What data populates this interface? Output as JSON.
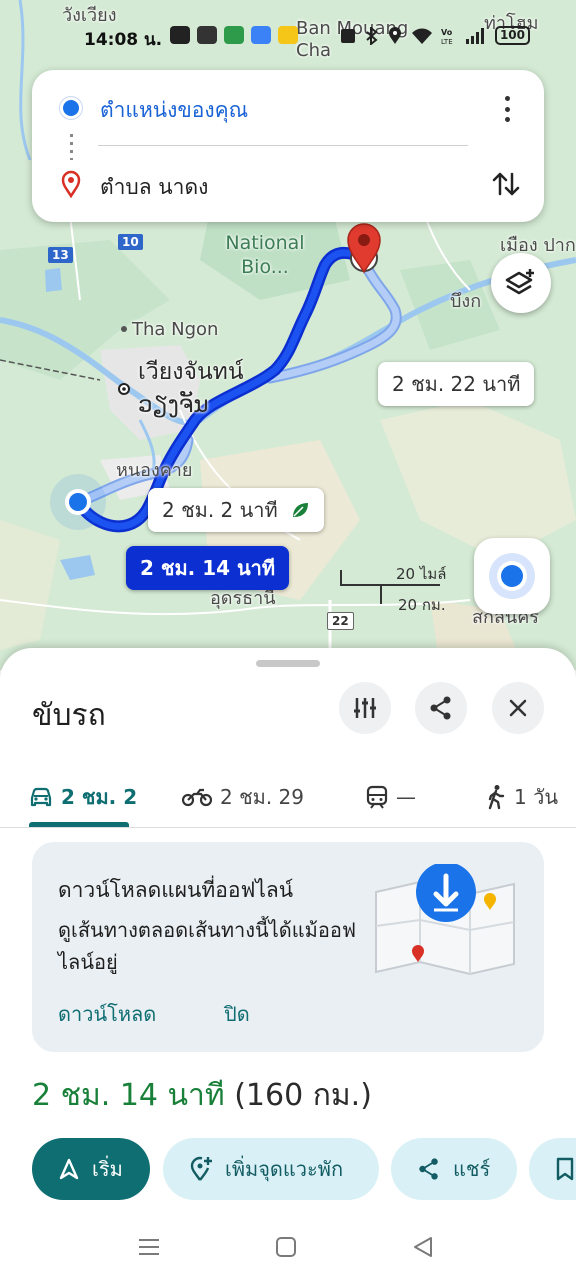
{
  "status_bar": {
    "time": "14:08 น.",
    "battery": "100"
  },
  "map": {
    "labels": {
      "wang_wiang": "วังเวียง",
      "ban_mouang_cha": "Ban Mouang Cha",
      "tha_hom": "ท่าโฮม",
      "national_bio": "National Bio...",
      "tha_ngon": "Tha Ngon",
      "vientiane_th": "เวียงจันทน์",
      "vientiane_lao": "ວຽງຈັນ",
      "nong_khai": "หนองคาย",
      "udon_thani": "อุดรธานี",
      "bueng_kan": "บึงก",
      "sakon_nakhon": "สกลนคร",
      "muang_pak": "เมือง ปาก"
    },
    "road_shields": [
      "13",
      "10",
      "22"
    ],
    "route_tags": {
      "primary": "2 ชม. 14 นาที",
      "alt_eco": "2 ชม. 2 นาที",
      "alt_east": "2 ชม. 22 นาที"
    },
    "scale": {
      "miles": "20 ไมล์",
      "km": "20 กม."
    }
  },
  "search": {
    "origin": "ตำแหน่งของคุณ",
    "destination": "ตำบล นาดง"
  },
  "sheet": {
    "title": "ขับรถ",
    "tabs": [
      {
        "label": "2 ชม. 2",
        "icon": "car-icon"
      },
      {
        "label": "2 ชม. 29",
        "icon": "motorbike-icon"
      },
      {
        "label": "—",
        "icon": "train-icon"
      },
      {
        "label": "1 วัน",
        "icon": "walk-icon"
      }
    ],
    "offline": {
      "title": "ดาวน์โหลดแผนที่ออฟไลน์",
      "desc": "ดูเส้นทางตลอดเส้นทางนี้ได้แม้ออฟไลน์อยู่",
      "download": "ดาวน์โหลด",
      "close": "ปิด"
    },
    "summary": {
      "duration": "2 ชม. 14 นาที",
      "distance": "(160 กม.)"
    },
    "actions": {
      "start": "เริ่ม",
      "add_stop": "เพิ่มจุดแวะพัก",
      "share": "แชร์"
    }
  },
  "colors": {
    "route_primary": "#0b2fd0",
    "route_alt": "#a9c3f0",
    "accent_teal": "#0f6e72",
    "duration_green": "#188038"
  }
}
